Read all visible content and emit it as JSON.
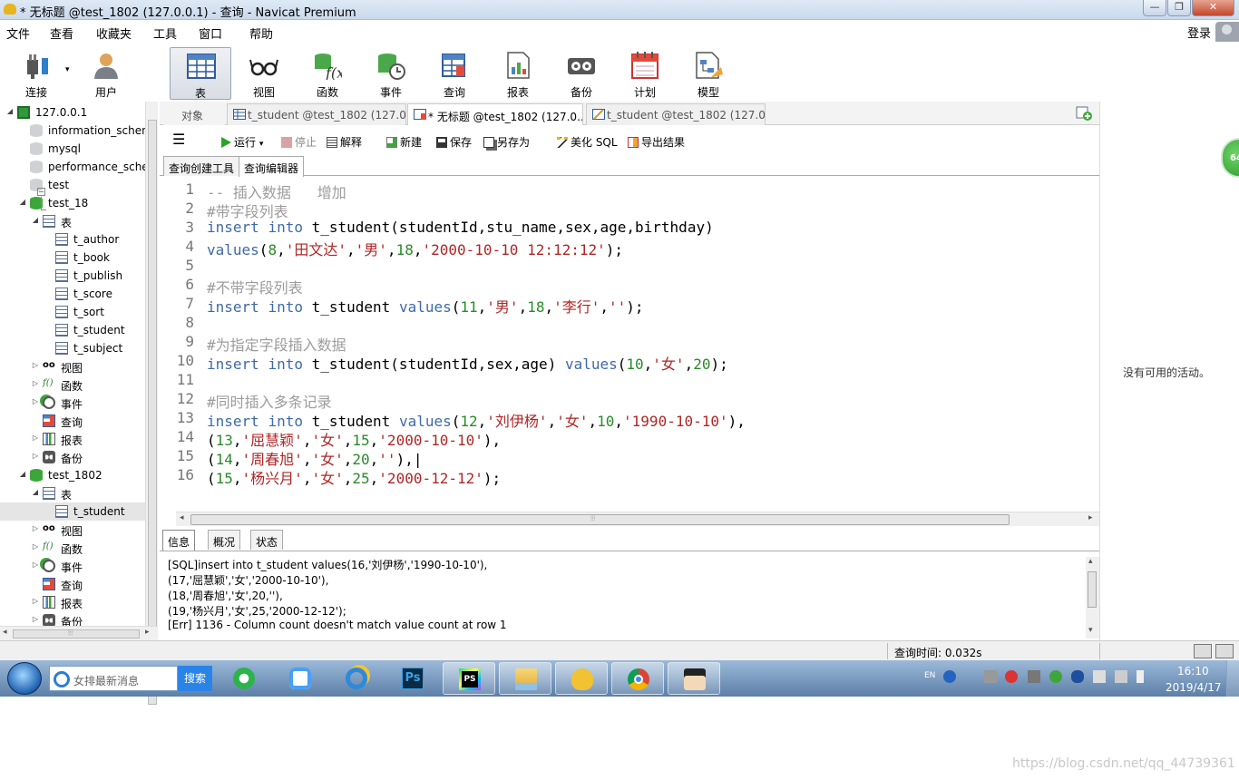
{
  "window": {
    "title": "* 无标题 @test_1802 (127.0.0.1) - 查询 - Navicat Premium",
    "min_glyph": "—",
    "max_glyph": "❐",
    "close_glyph": "✕"
  },
  "menu": {
    "items": [
      "文件",
      "查看",
      "收藏夹",
      "工具",
      "窗口",
      "帮助"
    ],
    "login": "登录"
  },
  "toolbar": {
    "items": [
      {
        "label": "连接",
        "icon": "plug-icon"
      },
      {
        "label": "用户",
        "icon": "user-icon"
      },
      {
        "label": "表",
        "icon": "table-icon"
      },
      {
        "label": "视图",
        "icon": "view-glasses-icon"
      },
      {
        "label": "函数",
        "icon": "function-icon"
      },
      {
        "label": "事件",
        "icon": "event-clock-icon"
      },
      {
        "label": "查询",
        "icon": "query-icon"
      },
      {
        "label": "报表",
        "icon": "report-icon"
      },
      {
        "label": "备份",
        "icon": "backup-icon"
      },
      {
        "label": "计划",
        "icon": "calendar-icon"
      },
      {
        "label": "模型",
        "icon": "model-icon"
      }
    ],
    "selected": "表",
    "dropdown_glyph": "▾"
  },
  "tree": {
    "nodes": [
      {
        "label": "127.0.0.1",
        "expanded": true
      },
      {
        "label": "information_schen"
      },
      {
        "label": "mysql"
      },
      {
        "label": "performance_sche"
      },
      {
        "label": "test"
      },
      {
        "label": "test_18",
        "expanded": true
      },
      {
        "label": "表",
        "expanded": true
      },
      {
        "label": "t_author"
      },
      {
        "label": "t_book"
      },
      {
        "label": "t_publish"
      },
      {
        "label": "t_score"
      },
      {
        "label": "t_sort"
      },
      {
        "label": "t_student"
      },
      {
        "label": "t_subject"
      },
      {
        "label": "视图"
      },
      {
        "label": "函数"
      },
      {
        "label": "事件"
      },
      {
        "label": "查询"
      },
      {
        "label": "报表"
      },
      {
        "label": "备份"
      },
      {
        "label": "test_1802",
        "expanded": true
      },
      {
        "label": "表",
        "expanded": true
      },
      {
        "label": "t_student",
        "selected": true
      },
      {
        "label": "视图"
      },
      {
        "label": "函数"
      },
      {
        "label": "事件"
      },
      {
        "label": "查询"
      },
      {
        "label": "报表"
      },
      {
        "label": "备份"
      }
    ],
    "expanded_glyph": "◢",
    "collapsed_glyph": "▷",
    "fx_glyph": "f()",
    "glasses_glyph": "oo"
  },
  "tabs": [
    {
      "label": "对象",
      "active": false
    },
    {
      "label": "t_student @test_1802 (127.0....",
      "active": false
    },
    {
      "label": "* 无标题 @test_1802 (127.0....",
      "active": true
    },
    {
      "label": "t_student @test_1802 (127.0...",
      "active": false
    }
  ],
  "query_toolbar": {
    "hamburger": "☰",
    "run": "运行",
    "run_arrow": "▾",
    "stop": "停止",
    "explain": "解释",
    "new": "新建",
    "save": "保存",
    "save_as": "另存为",
    "beautify": "美化 SQL",
    "export": "导出结果"
  },
  "subtabs": [
    "查询创建工具",
    "查询编辑器"
  ],
  "editor": {
    "fold_glyph": "−",
    "line_numbers": [
      "1",
      "2",
      "3",
      "4",
      "5",
      "6",
      "7",
      "8",
      "9",
      "10",
      "11",
      "12",
      "13",
      "14",
      "15",
      "16"
    ],
    "lines": [
      [
        {
          "t": "-- 插入数据   增加",
          "c": "cmt"
        }
      ],
      [
        {
          "t": "#带字段列表",
          "c": "cmt"
        }
      ],
      [
        {
          "t": "insert",
          "c": "kw"
        },
        {
          "t": " ",
          "c": "plain"
        },
        {
          "t": "into",
          "c": "kw"
        },
        {
          "t": " t_student(studentId,stu_name,sex,age,birthday)",
          "c": "plain"
        }
      ],
      [
        {
          "t": "values",
          "c": "kw"
        },
        {
          "t": "(",
          "c": "plain"
        },
        {
          "t": "8",
          "c": "num"
        },
        {
          "t": ",",
          "c": "plain"
        },
        {
          "t": "'田文达'",
          "c": "str"
        },
        {
          "t": ",",
          "c": "plain"
        },
        {
          "t": "'男'",
          "c": "str"
        },
        {
          "t": ",",
          "c": "plain"
        },
        {
          "t": "18",
          "c": "num"
        },
        {
          "t": ",",
          "c": "plain"
        },
        {
          "t": "'2000-10-10 12:12:12'",
          "c": "str"
        },
        {
          "t": ");",
          "c": "plain"
        }
      ],
      [],
      [
        {
          "t": "#不带字段列表",
          "c": "cmt"
        }
      ],
      [
        {
          "t": "insert",
          "c": "kw"
        },
        {
          "t": " ",
          "c": "plain"
        },
        {
          "t": "into",
          "c": "kw"
        },
        {
          "t": " t_student ",
          "c": "plain"
        },
        {
          "t": "values",
          "c": "kw"
        },
        {
          "t": "(",
          "c": "plain"
        },
        {
          "t": "11",
          "c": "num"
        },
        {
          "t": ",",
          "c": "plain"
        },
        {
          "t": "'男'",
          "c": "str"
        },
        {
          "t": ",",
          "c": "plain"
        },
        {
          "t": "18",
          "c": "num"
        },
        {
          "t": ",",
          "c": "plain"
        },
        {
          "t": "'李行'",
          "c": "str"
        },
        {
          "t": ",",
          "c": "plain"
        },
        {
          "t": "''",
          "c": "str"
        },
        {
          "t": ");",
          "c": "plain"
        }
      ],
      [],
      [
        {
          "t": "#为指定字段插入数据",
          "c": "cmt"
        }
      ],
      [
        {
          "t": "insert",
          "c": "kw"
        },
        {
          "t": " ",
          "c": "plain"
        },
        {
          "t": "into",
          "c": "kw"
        },
        {
          "t": " t_student(studentId,sex,age) ",
          "c": "plain"
        },
        {
          "t": "values",
          "c": "kw"
        },
        {
          "t": "(",
          "c": "plain"
        },
        {
          "t": "10",
          "c": "num"
        },
        {
          "t": ",",
          "c": "plain"
        },
        {
          "t": "'女'",
          "c": "str"
        },
        {
          "t": ",",
          "c": "plain"
        },
        {
          "t": "20",
          "c": "num"
        },
        {
          "t": ");",
          "c": "plain"
        }
      ],
      [],
      [
        {
          "t": "#同时插入多条记录",
          "c": "cmt"
        }
      ],
      [
        {
          "t": "insert",
          "c": "kw"
        },
        {
          "t": " ",
          "c": "plain"
        },
        {
          "t": "into",
          "c": "kw"
        },
        {
          "t": " t_student ",
          "c": "plain"
        },
        {
          "t": "values",
          "c": "kw"
        },
        {
          "t": "(",
          "c": "plain"
        },
        {
          "t": "12",
          "c": "num"
        },
        {
          "t": ",",
          "c": "plain"
        },
        {
          "t": "'刘伊杨'",
          "c": "str"
        },
        {
          "t": ",",
          "c": "plain"
        },
        {
          "t": "'女'",
          "c": "str"
        },
        {
          "t": ",",
          "c": "plain"
        },
        {
          "t": "10",
          "c": "num"
        },
        {
          "t": ",",
          "c": "plain"
        },
        {
          "t": "'1990-10-10'",
          "c": "str"
        },
        {
          "t": "),",
          "c": "plain"
        }
      ],
      [
        {
          "t": "(",
          "c": "plain"
        },
        {
          "t": "13",
          "c": "num"
        },
        {
          "t": ",",
          "c": "plain"
        },
        {
          "t": "'屈慧颖'",
          "c": "str"
        },
        {
          "t": ",",
          "c": "plain"
        },
        {
          "t": "'女'",
          "c": "str"
        },
        {
          "t": ",",
          "c": "plain"
        },
        {
          "t": "15",
          "c": "num"
        },
        {
          "t": ",",
          "c": "plain"
        },
        {
          "t": "'2000-10-10'",
          "c": "str"
        },
        {
          "t": "),",
          "c": "plain"
        }
      ],
      [
        {
          "t": "(",
          "c": "plain"
        },
        {
          "t": "14",
          "c": "num"
        },
        {
          "t": ",",
          "c": "plain"
        },
        {
          "t": "'周春旭'",
          "c": "str"
        },
        {
          "t": ",",
          "c": "plain"
        },
        {
          "t": "'女'",
          "c": "str"
        },
        {
          "t": ",",
          "c": "plain"
        },
        {
          "t": "20",
          "c": "num"
        },
        {
          "t": ",",
          "c": "plain"
        },
        {
          "t": "''",
          "c": "str"
        },
        {
          "t": "),|",
          "c": "plain"
        }
      ],
      [
        {
          "t": "(",
          "c": "plain"
        },
        {
          "t": "15",
          "c": "num"
        },
        {
          "t": ",",
          "c": "plain"
        },
        {
          "t": "'杨兴月'",
          "c": "str"
        },
        {
          "t": ",",
          "c": "plain"
        },
        {
          "t": "'女'",
          "c": "str"
        },
        {
          "t": ",",
          "c": "plain"
        },
        {
          "t": "25",
          "c": "num"
        },
        {
          "t": ",",
          "c": "plain"
        },
        {
          "t": "'2000-12-12'",
          "c": "str"
        },
        {
          "t": ");",
          "c": "plain"
        }
      ]
    ]
  },
  "scrollbars": {
    "grip": "⦙⦙⦙",
    "left": "◂",
    "right": "▸",
    "up": "▴",
    "down": "▾"
  },
  "result_tabs": [
    "信息",
    "概况",
    "状态"
  ],
  "messages": [
    "[SQL]insert into t_student values(16,'刘伊杨','1990-10-10'),",
    "(17,'屈慧颖','女','2000-10-10'),",
    "(18,'周春旭','女',20,''),",
    "(19,'杨兴月','女',25,'2000-12-12');",
    "[Err] 1136 - Column count doesn't match value count at row 1"
  ],
  "right_panel": {
    "no_activity": "没有可用的活动。",
    "badge": "64"
  },
  "status": {
    "query_time": "查询时间: 0.032s"
  },
  "taskbar": {
    "search_placeholder": "女排最新消息",
    "search_button": "搜索",
    "ps_label": "Ps",
    "pycharm_label": "PS",
    "lang": "EN",
    "time": "16:10",
    "date": "2019/4/17"
  },
  "watermark": "https://blog.csdn.net/qq_44739361",
  "colors": {
    "keyword": "#3e6aa8",
    "string": "#b02626",
    "number": "#2a8a2a",
    "comment": "#9c9c9c"
  }
}
